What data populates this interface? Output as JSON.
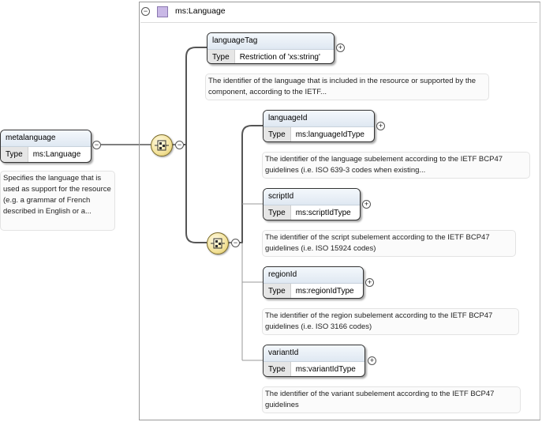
{
  "root": {
    "name": "metalanguage",
    "type_key": "Type",
    "type_value": "ms:Language",
    "doc": "Specifies the language that is used as support for the resource (e.g. a grammar of French described in English or a..."
  },
  "complex_type": {
    "label": "ms:Language"
  },
  "language_tag": {
    "name": "languageTag",
    "type_key": "Type",
    "type_value": "Restriction of 'xs:string'",
    "doc": "The identifier of the language that is included in the resource or supported by the component, according to the IETF..."
  },
  "children": [
    {
      "name": "languageId",
      "type_key": "Type",
      "type_value": "ms:languageIdType",
      "doc": "The identifier of the language subelement according to the IETF BCP47 guidelines (i.e. ISO 639-3 codes when existing..."
    },
    {
      "name": "scriptId",
      "type_key": "Type",
      "type_value": "ms:scriptIdType",
      "doc": "The identifier of the script subelement according to the IETF BCP47 guidelines (i.e. ISO 15924 codes)"
    },
    {
      "name": "regionId",
      "type_key": "Type",
      "type_value": "ms:regionIdType",
      "doc": "The identifier of the region subelement according to the IETF BCP47 guidelines (i.e. ISO 3166 codes)"
    },
    {
      "name": "variantId",
      "type_key": "Type",
      "type_value": "ms:variantIdType",
      "doc": "The identifier of the variant subelement according to the IETF BCP47 guidelines"
    }
  ],
  "icons": {
    "collapse": "minus-icon",
    "expand": "plus-icon",
    "sequence": "sequence-compositor-icon",
    "type": "complex-type-icon"
  },
  "colors": {
    "connector": "#555555",
    "compositor_fill": "#f3e29a",
    "type_icon": "#c9b8e6"
  }
}
